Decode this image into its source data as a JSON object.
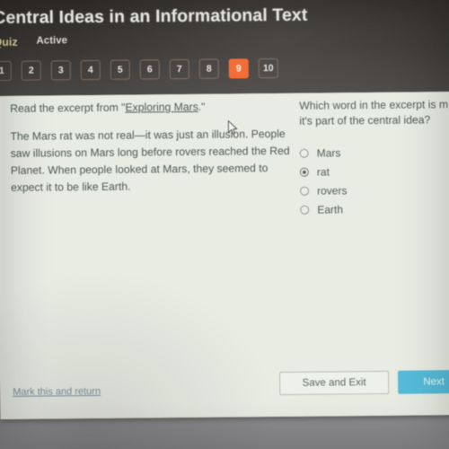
{
  "header": {
    "title": "Central Ideas in an Informational Text",
    "kind_label": "Quiz",
    "status_label": "Active",
    "current_question": "9",
    "accent_color": "#f4622a",
    "pills": [
      "1",
      "2",
      "3",
      "4",
      "5",
      "6",
      "7",
      "8",
      "9",
      "10"
    ]
  },
  "passage": {
    "lead_prefix": "Read the excerpt from \"",
    "lead_link": "Exploring Mars",
    "lead_suffix": ".\"",
    "body": "The Mars rat was not real—it was just an illusion. People saw illusions on Mars long before rovers reached the Red Planet. When people looked at Mars, they seemed to expect it to be like Earth."
  },
  "question": {
    "line1": "Which word in the excerpt is m",
    "line2": "it's part of the central idea?",
    "selected": "rat",
    "options": [
      {
        "label": "Mars",
        "selected": false
      },
      {
        "label": "rat",
        "selected": true
      },
      {
        "label": "rovers",
        "selected": false
      },
      {
        "label": "Earth",
        "selected": false
      }
    ]
  },
  "footer": {
    "mark_link": "Mark this and return",
    "save_label": "Save and Exit",
    "next_label": "Next",
    "next_color": "#56bcd9"
  }
}
